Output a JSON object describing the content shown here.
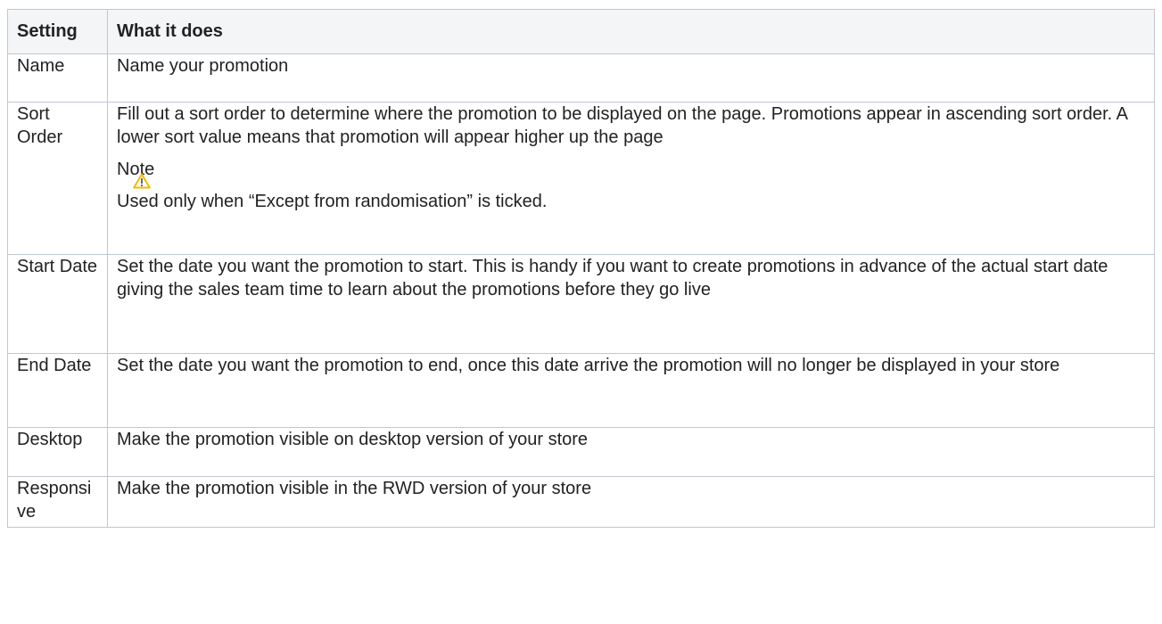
{
  "table": {
    "headers": {
      "setting": "Setting",
      "what_it_does": "What it does"
    },
    "rows": [
      {
        "setting": "Name",
        "description": "Name your promotion"
      },
      {
        "setting": "Sort Order",
        "description": "Fill out a sort order to determine where the promotion to be displayed on the page. Promotions appear in ascending sort order. A lower sort value means that promotion will appear higher up the page",
        "note": {
          "title": "Note",
          "icon": "warning-icon",
          "text": "Used only when “Except from randomisation” is ticked."
        }
      },
      {
        "setting": "Start Date",
        "description": "Set the date you want the promotion to start. This is handy if you want to create promotions in advance of the actual start date giving the sales team time to learn about the promotions before they go live"
      },
      {
        "setting": "End Date",
        "description": "Set the date you want the promotion to end, once this date arrive the promotion will no longer be displayed in your store"
      },
      {
        "setting": "Desktop",
        "description": "Make the promotion visible on desktop version of your store"
      },
      {
        "setting": "Responsive",
        "description": "Make the promotion visible in the RWD version of your store"
      }
    ]
  },
  "colors": {
    "border": "#c1c7d0",
    "header_bg": "#f4f5f7",
    "warning_icon": "#f5b900"
  }
}
